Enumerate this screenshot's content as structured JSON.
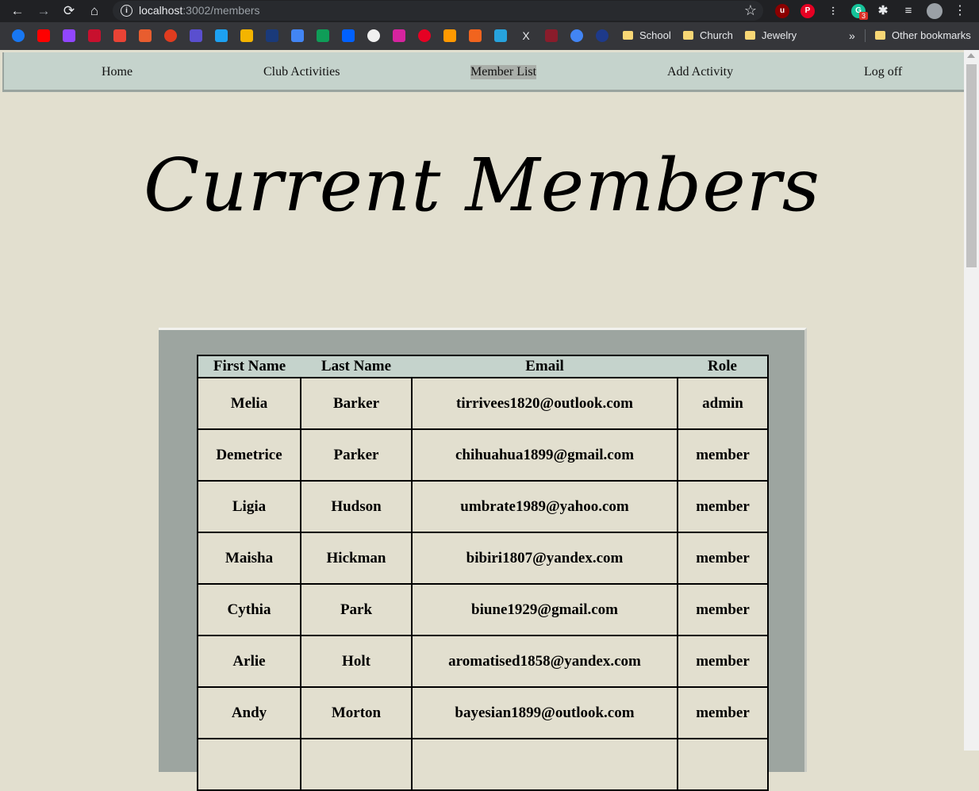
{
  "browser": {
    "url_host": "localhost",
    "url_rest": ":3002/members",
    "extension_badge": "3",
    "bookmarks": [
      "School",
      "Church",
      "Jewelry"
    ],
    "other_bookmarks": "Other bookmarks",
    "overflow": "»"
  },
  "nav": {
    "items": [
      "Home",
      "Club Activities",
      "Member List",
      "Add Activity",
      "Log off"
    ],
    "active": "Member List"
  },
  "page": {
    "title": "Current Members"
  },
  "table": {
    "headers": [
      "First Name",
      "Last Name",
      "Email",
      "Role"
    ],
    "rows": [
      [
        "Melia",
        "Barker",
        "tirrivees1820@outlook.com",
        "admin"
      ],
      [
        "Demetrice",
        "Parker",
        "chihuahua1899@gmail.com",
        "member"
      ],
      [
        "Ligia",
        "Hudson",
        "umbrate1989@yahoo.com",
        "member"
      ],
      [
        "Maisha",
        "Hickman",
        "bibiri1807@yandex.com",
        "member"
      ],
      [
        "Cythia",
        "Park",
        "biune1929@gmail.com",
        "member"
      ],
      [
        "Arlie",
        "Holt",
        "aromatised1858@yandex.com",
        "member"
      ],
      [
        "Andy",
        "Morton",
        "bayesian1899@outlook.com",
        "member"
      ],
      [
        "",
        "",
        "",
        ""
      ]
    ]
  }
}
